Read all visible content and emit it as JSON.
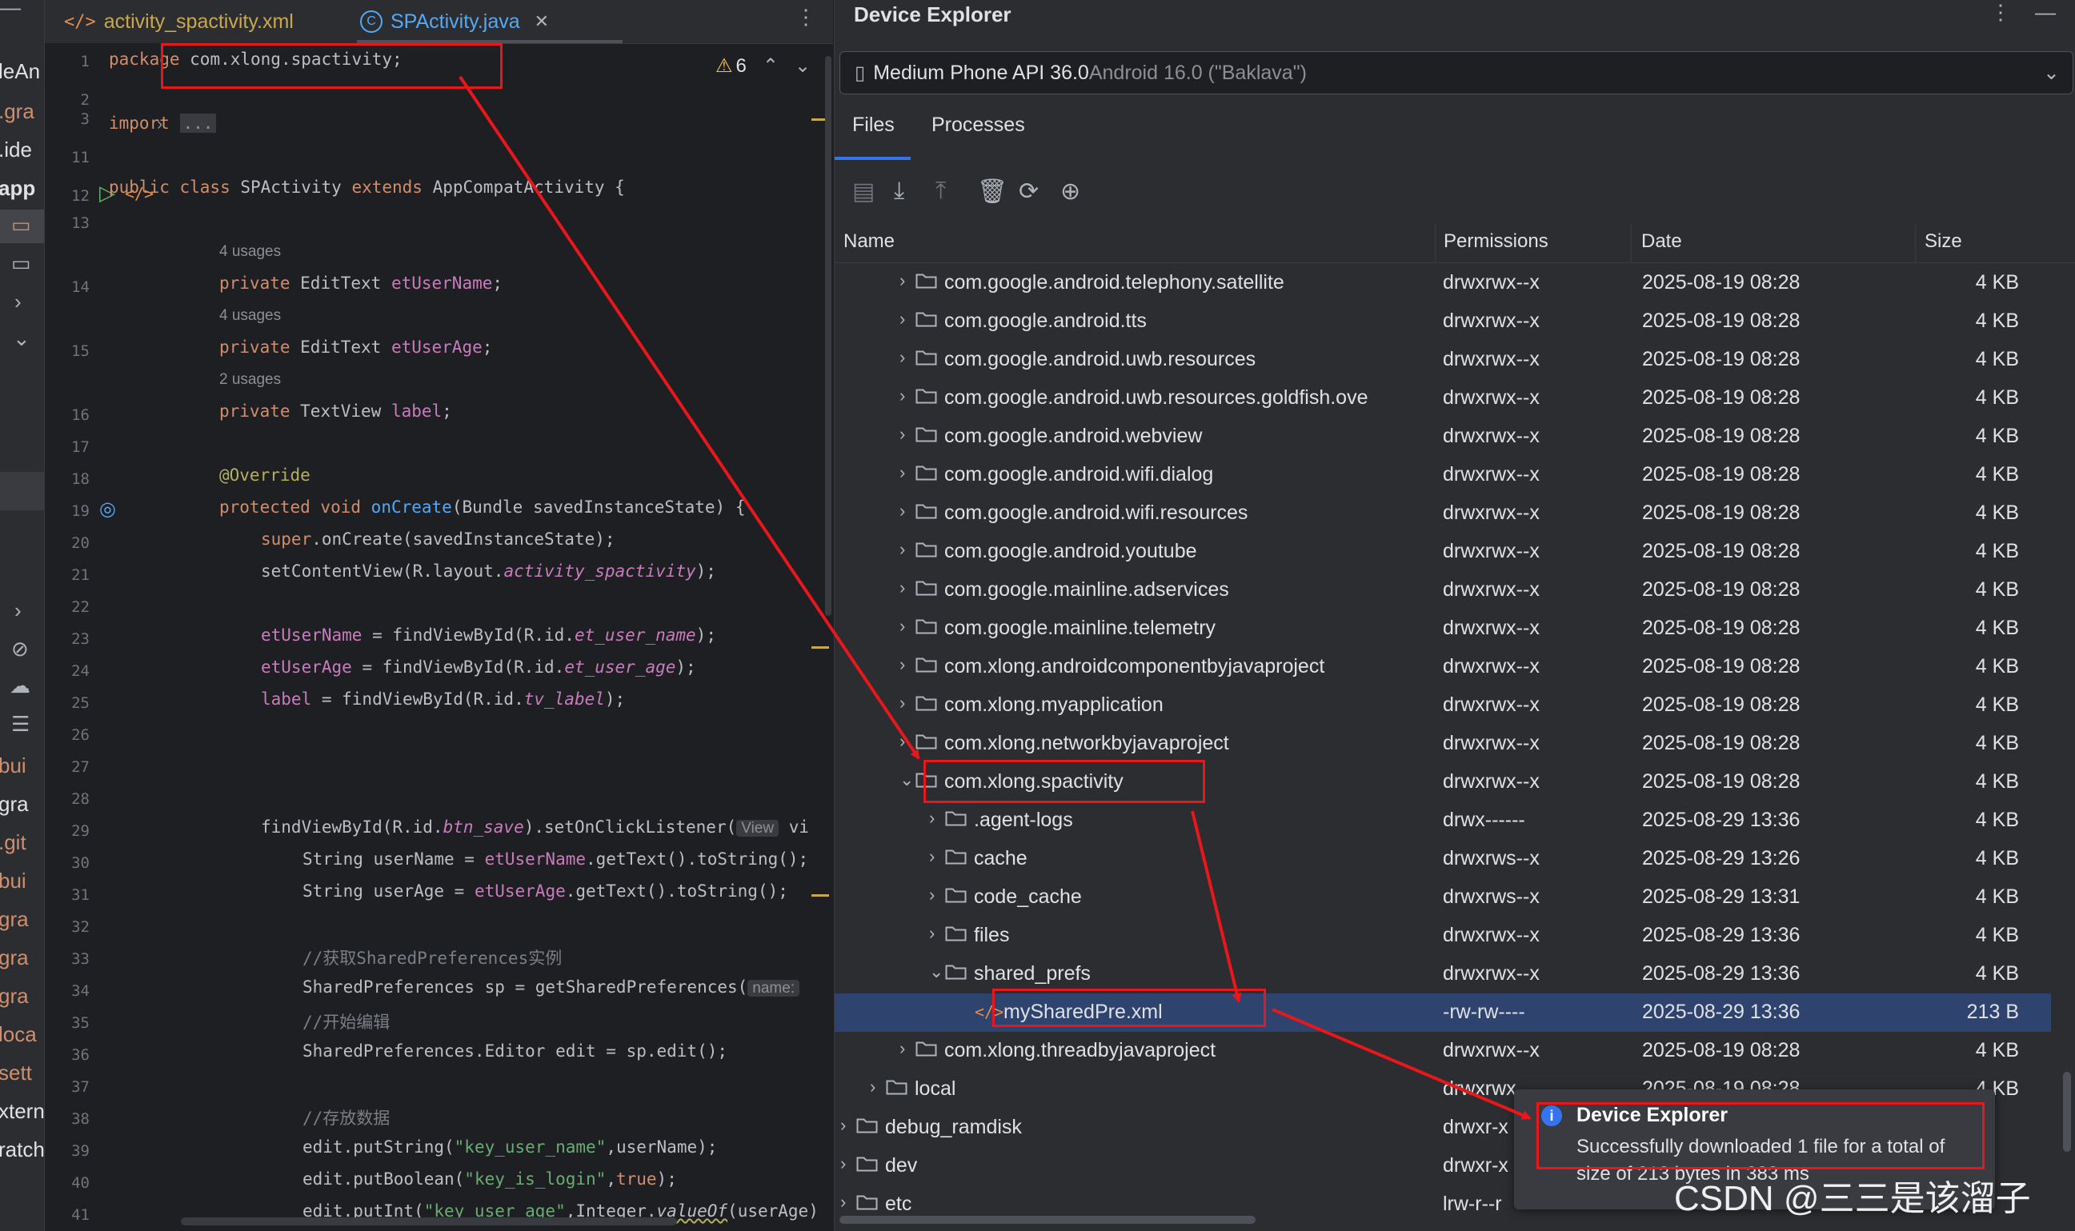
{
  "left_panel": {
    "fragments": [
      "leAn",
      ".gra",
      ".ide",
      "app",
      "bui",
      "gra",
      ".git",
      "bui",
      "gra",
      "gra",
      "gra",
      "loca",
      "sett",
      "xtern",
      "ratch"
    ]
  },
  "editor": {
    "tabs": [
      {
        "label": "activity_spactivity.xml",
        "icon": "xml-file-icon"
      },
      {
        "label": "SPActivity.java",
        "icon": "java-class-icon"
      }
    ],
    "warning_count": "6",
    "lines": {
      "l1": "1",
      "l2": "2",
      "l3": "3",
      "l11": "11",
      "l12": "12",
      "l13": "13",
      "l14": "14",
      "l15": "15",
      "l16": "16",
      "l17": "17",
      "l18": "18",
      "l19": "19",
      "l20": "20",
      "l21": "21",
      "l22": "22",
      "l23": "23",
      "l24": "24",
      "l25": "25",
      "l26": "26",
      "l27": "27",
      "l28": "28",
      "l29": "29",
      "l30": "30",
      "l31": "31",
      "l32": "32",
      "l33": "33",
      "l34": "34",
      "l35": "35",
      "l36": "36",
      "l37": "37",
      "l38": "38",
      "l39": "39",
      "l40": "40",
      "l41": "41"
    },
    "code": {
      "pkg_kw": "package",
      "pkg_name": " com.xlong.spactivity;",
      "import_kw": "import",
      "import_fold": "...",
      "c12a": "public class",
      "c12b": " SPActivity ",
      "c12c": "extends",
      "c12d": " AppCompatActivity {",
      "usages14": "4 usages",
      "c14a": "private",
      "c14b": " EditText ",
      "c14c": "etUserName",
      "c14d": ";",
      "usages15": "4 usages",
      "c15a": "private",
      "c15b": " EditText ",
      "c15c": "etUserAge",
      "c15d": ";",
      "usages16": "2 usages",
      "c16a": "private",
      "c16b": " TextView ",
      "c16c": "label",
      "c16d": ";",
      "c18": "@Override",
      "c19a": "protected void",
      "c19b": " ",
      "c19c": "onCreate",
      "c19d": "(Bundle savedInstanceState) {",
      "c20a": "super",
      "c20b": ".onCreate(savedInstanceState);",
      "c21a": "setContentView(R.layout.",
      "c21b": "activity_spactivity",
      "c21c": ");",
      "c23a": "etUserName",
      "c23b": " = findViewById(R.id.",
      "c23c": "et_user_name",
      "c23d": ");",
      "c24a": "etUserAge",
      "c24b": " = findViewById(R.id.",
      "c24c": "et_user_age",
      "c24d": ");",
      "c25a": "label",
      "c25b": " = findViewById(R.id.",
      "c25c": "tv_label",
      "c25d": ");",
      "c29a": "findViewById(R.id.",
      "c29b": "btn_save",
      "c29c": ").setOnClickListener(",
      "c29hint": "View",
      "c29d": " vi",
      "c30a": "String userName = ",
      "c30b": "etUserName",
      "c30c": ".getText().toString();",
      "c31a": "String userAge = ",
      "c31b": "etUserAge",
      "c31c": ".getText().toString();",
      "c33": "//获取SharedPreferences实例",
      "c34a": "SharedPreferences sp = getSharedPreferences(",
      "c34hint": "name:",
      "c35": "//开始编辑",
      "c36": "SharedPreferences.Editor edit = sp.edit();",
      "c38": "//存放数据",
      "c39a": "edit.putString(",
      "c39b": "\"key_user_name\"",
      "c39c": ",userName);",
      "c40a": "edit.putBoolean(",
      "c40b": "\"key_is_login\"",
      "c40c": ",",
      "c40d": "true",
      "c40e": ");",
      "c41a": "edit.putInt(",
      "c41b": "\"key_user_age\"",
      "c41c": ",Integer.",
      "c41d": "valueOf",
      "c41e": "(userAge)"
    }
  },
  "device_explorer": {
    "title": "Device Explorer",
    "device": {
      "name": "Medium Phone API 36.0",
      "detail": " Android 16.0 (\"Baklava\")"
    },
    "tabs": [
      "Files",
      "Processes"
    ],
    "columns": [
      "Name",
      "Permissions",
      "Date",
      "Size"
    ],
    "rows": [
      {
        "name": "com.google.android.telephony.satellite",
        "perm": "drwxrwx--x",
        "date": "2025-08-19 08:28",
        "size": "4 KB"
      },
      {
        "name": "com.google.android.tts",
        "perm": "drwxrwx--x",
        "date": "2025-08-19 08:28",
        "size": "4 KB"
      },
      {
        "name": "com.google.android.uwb.resources",
        "perm": "drwxrwx--x",
        "date": "2025-08-19 08:28",
        "size": "4 KB"
      },
      {
        "name": "com.google.android.uwb.resources.goldfish.ove",
        "perm": "drwxrwx--x",
        "date": "2025-08-19 08:28",
        "size": "4 KB"
      },
      {
        "name": "com.google.android.webview",
        "perm": "drwxrwx--x",
        "date": "2025-08-19 08:28",
        "size": "4 KB"
      },
      {
        "name": "com.google.android.wifi.dialog",
        "perm": "drwxrwx--x",
        "date": "2025-08-19 08:28",
        "size": "4 KB"
      },
      {
        "name": "com.google.android.wifi.resources",
        "perm": "drwxrwx--x",
        "date": "2025-08-19 08:28",
        "size": "4 KB"
      },
      {
        "name": "com.google.android.youtube",
        "perm": "drwxrwx--x",
        "date": "2025-08-19 08:28",
        "size": "4 KB"
      },
      {
        "name": "com.google.mainline.adservices",
        "perm": "drwxrwx--x",
        "date": "2025-08-19 08:28",
        "size": "4 KB"
      },
      {
        "name": "com.google.mainline.telemetry",
        "perm": "drwxrwx--x",
        "date": "2025-08-19 08:28",
        "size": "4 KB"
      },
      {
        "name": "com.xlong.androidcomponentbyjavaproject",
        "perm": "drwxrwx--x",
        "date": "2025-08-19 08:28",
        "size": "4 KB"
      },
      {
        "name": "com.xlong.myapplication",
        "perm": "drwxrwx--x",
        "date": "2025-08-19 08:28",
        "size": "4 KB"
      },
      {
        "name": "com.xlong.networkbyjavaproject",
        "perm": "drwxrwx--x",
        "date": "2025-08-19 08:28",
        "size": "4 KB"
      },
      {
        "name": "com.xlong.spactivity",
        "perm": "drwxrwx--x",
        "date": "2025-08-19 08:28",
        "size": "4 KB"
      },
      {
        "name": ".agent-logs",
        "perm": "drwx------",
        "date": "2025-08-29 13:36",
        "size": "4 KB"
      },
      {
        "name": "cache",
        "perm": "drwxrws--x",
        "date": "2025-08-29 13:26",
        "size": "4 KB"
      },
      {
        "name": "code_cache",
        "perm": "drwxrws--x",
        "date": "2025-08-29 13:31",
        "size": "4 KB"
      },
      {
        "name": "files",
        "perm": "drwxrwx--x",
        "date": "2025-08-29 13:36",
        "size": "4 KB"
      },
      {
        "name": "shared_prefs",
        "perm": "drwxrwx--x",
        "date": "2025-08-29 13:36",
        "size": "4 KB"
      },
      {
        "name": "mySharedPre.xml",
        "perm": "-rw-rw----",
        "date": "2025-08-29 13:36",
        "size": "213 B"
      },
      {
        "name": "com.xlong.threadbyjavaproject",
        "perm": "drwxrwx--x",
        "date": "2025-08-19 08:28",
        "size": "4 KB"
      },
      {
        "name": "local",
        "perm": "drwxrwx",
        "date": "2025-08-19 08:28",
        "size": "4 KB"
      },
      {
        "name": "debug_ramdisk",
        "perm": "drwxr-x",
        "date": "",
        "size": ""
      },
      {
        "name": "dev",
        "perm": "drwxr-x",
        "date": "",
        "size": ""
      },
      {
        "name": "etc",
        "perm": "lrw-r--r",
        "date": "",
        "size": ""
      }
    ]
  },
  "notification": {
    "title": "Device Explorer",
    "message_line1": "Successfully downloaded 1 file for a total of",
    "message_line2": "size of 213 bytes in 383 ms"
  },
  "watermark": "CSDN @三三是该溜子"
}
